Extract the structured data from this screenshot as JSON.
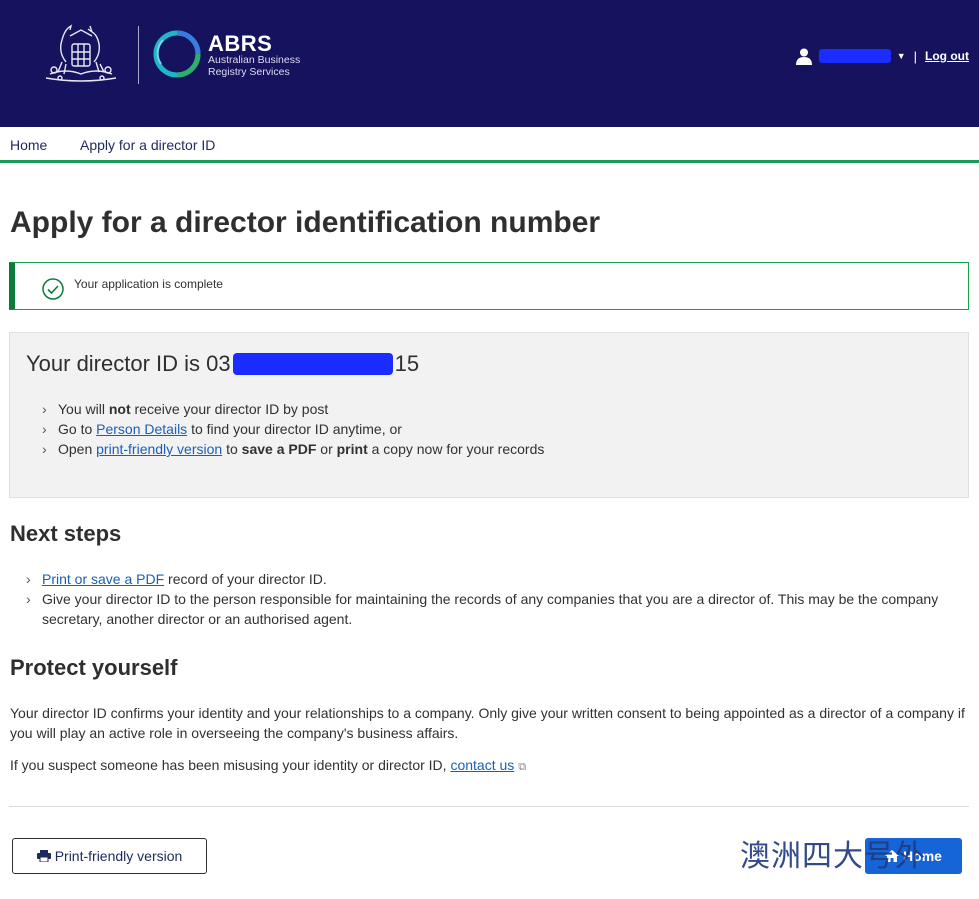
{
  "header": {
    "brand_title": "ABRS",
    "brand_subtitle_1": "Australian Business",
    "brand_subtitle_2": "Registry Services",
    "logout_label": "Log out",
    "separator": "|",
    "background_color": "#15125e"
  },
  "breadcrumb": {
    "items": [
      {
        "label": "Home"
      },
      {
        "label": "Apply for a director ID"
      }
    ],
    "accent_color": "#1a9a5a"
  },
  "page": {
    "title": "Apply for a director identification number"
  },
  "alert": {
    "message": "Your application is complete",
    "status_color": "#17a34a"
  },
  "director_id": {
    "heading_prefix": "Your director ID is 03",
    "heading_suffix": "15",
    "items": [
      {
        "before": "You will ",
        "bold": "not",
        "after": " receive your director ID by post"
      },
      {
        "before": "Go to ",
        "link": "Person Details",
        "after": " to find your director ID anytime, or"
      },
      {
        "before": "Open ",
        "link": "print-friendly version",
        "mid1": " to ",
        "bold1": "save a PDF",
        "mid2": " or ",
        "bold2": "print",
        "after": " a copy now for your records"
      }
    ]
  },
  "next_steps": {
    "heading": "Next steps",
    "item1_link": "Print or save a PDF",
    "item1_after": " record of your director ID.",
    "item2": "Give your director ID to the person responsible for maintaining the records of any companies that you are a director of. This may be the company secretary, another director or an authorised agent."
  },
  "protect": {
    "heading": "Protect yourself",
    "para1": "Your director ID confirms your identity and your relationships to a company. Only give your written consent to being appointed as a director of a company if you will play an active role in overseeing the company's business affairs.",
    "para2_before": "If you suspect someone has been misusing your identity or director ID, ",
    "para2_link": "contact us"
  },
  "actions": {
    "print_label": "Print-friendly version",
    "home_label": "Home",
    "home_color": "#1565d8"
  },
  "watermark": "澳洲四大号外"
}
